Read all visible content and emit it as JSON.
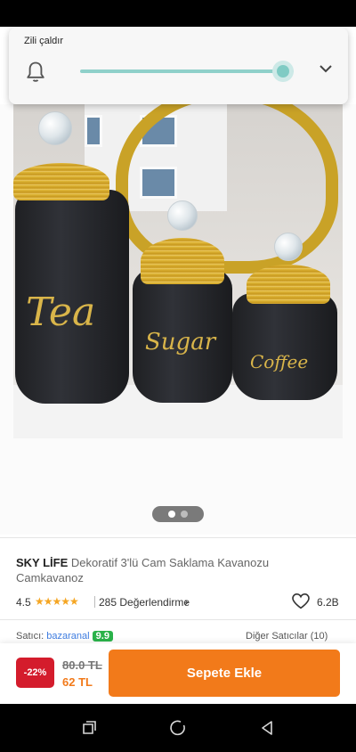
{
  "volume_panel": {
    "title": "Zili çaldır",
    "level": 0.95,
    "bell_icon": "bell-icon",
    "expand_icon": "chevron-down-icon"
  },
  "product_image": {
    "jar_labels": [
      "Tea",
      "Sugar",
      "Coffee"
    ],
    "carousel": {
      "total": 2,
      "active": 1
    }
  },
  "product": {
    "brand": "SKY LİFE",
    "name": "Dekoratif 3'lü Cam Saklama Kavanozu Camkavanoz",
    "rating": "4.5",
    "stars": "★★★★★",
    "review_count": "285 Değerlendirme",
    "favorites": "6.2B"
  },
  "seller": {
    "label": "Satıcı:",
    "name": "bazaranal",
    "score": "9.9",
    "other_sellers": "Diğer Satıcılar (10)"
  },
  "purchase_bar": {
    "discount": "-22%",
    "old_price": "80.0 TL",
    "new_price": "62 TL",
    "add_to_cart": "Sepete Ekle"
  },
  "colors": {
    "accent_orange": "#f27a1a",
    "discount_red": "#d41c2c",
    "slider_teal": "#7fcbc4",
    "star_yellow": "#f5a623",
    "gold": "#d9b54a"
  },
  "nav_icons": [
    "recent-apps-icon",
    "home-icon",
    "back-icon"
  ]
}
